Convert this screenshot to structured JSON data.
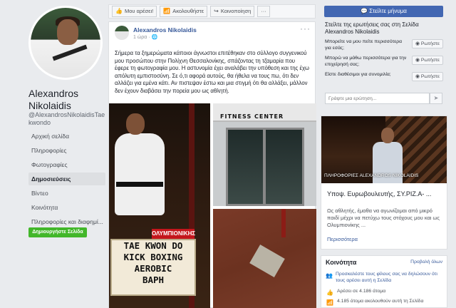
{
  "page": {
    "name": "Alexandros Nikolaidis",
    "handle": "@AlexandrosNikolaidisTaekwondo",
    "nav": [
      "Αρχική σελίδα",
      "Πληροφορίες",
      "Φωτογραφίες",
      "Δημοσιεύσεις",
      "Βίντεο",
      "Κοινότητα",
      "Πληροφορίες και διαφημί..."
    ],
    "create_page": "Δημιουργήστε Σελίδα"
  },
  "actions": {
    "like": "Μου αρέσει!",
    "follow": "Ακολουθήστε",
    "share": "Κοινοποίηση",
    "more": "···"
  },
  "post": {
    "author": "Alexandros Nikolaidis",
    "time": "1 ώρα · ",
    "more": "···",
    "text": "Σήμερα τα ξημερώματα κάποιοι άγνωστοι επιτέθηκαν στο σύλλογο συγγενικού μου προσώπου στην Πολίχνη Θεσσαλονίκης, σπάζοντας τη τζαμαρία που έφερε τη φωτογραφία μου. Η αστυνομία έχει αναλάβει την υπόθεση και της έχω απόλυτη εμπιστοσύνη. Σε ό,τι αφορά αυτούς, θα ήθελα να τους πω, ότι δεν αλλάζει για εμένα κάτι. Αν πιστεψαν έστω και μια στιγμή ότι θα αλλάξει, μάλλον δεν έχουν διαβάσει την πορεία μου ως αθλητή.",
    "photo_signs": {
      "olympic": "ΟΛΥΜΠΙΟΝΙΚΗΣ",
      "board": [
        "TAE KWON DO",
        "KICK BOXING",
        "AEROBIC",
        "ΒΑΡΗ"
      ],
      "gym": "FITNESS CENTER"
    }
  },
  "sidebar": {
    "message_button": "Στείλτε μήνυμα",
    "qa_title": "Στείλτε της ερωτήσεις σας στη Σελίδα Alexandros Nikolaidis",
    "questions": [
      {
        "text": "Μπορείτε να μου πείτε περισσότερα για εσάς;",
        "ask": "Ρωτήστε"
      },
      {
        "text": "Μπορώ να μάθω περισσότερα για την επιχείρησή σας;",
        "ask": "Ρωτήστε"
      },
      {
        "text": "Είστε διαθέσιμοι για συνομιλία;",
        "ask": "Ρωτήστε"
      }
    ],
    "qa_placeholder": "Γράψτε μια ερώτηση...",
    "qa_send": "➤",
    "info_caption": "ΠΛΗΡΟΦΟΡΙΕΣ ALEXANDROS NIKOLAIDIS",
    "info_name": "Υποψ. Ευρωβουλευτής, ΣΥ.ΡΙΖ.Α- ...",
    "info_desc": "Ως αθλητής, έμαθα να αγωνίζομαι από μικρό παιδί μέχρι να πετύχω τους στόχους μου και ως Ολυμπιονίκης ...",
    "info_more": "Περισσότερα",
    "community_title": "Κοινότητα",
    "community_all": "Προβολή όλων",
    "community_rows": [
      {
        "icon": "invite-icon",
        "text": "Προσκαλέστε τους φίλους σας να δηλώσουν ότι τους αρέσει αυτή η Σελίδα"
      },
      {
        "icon": "like-icon",
        "text": "Αρέσει σε 4.186 άτομα"
      },
      {
        "icon": "follow-icon",
        "text": "4.185 άτομα ακολουθούν αυτή τη Σελίδα"
      }
    ]
  },
  "colors": {
    "brand": "#4267b2",
    "link": "#365899",
    "create_green": "#42b72a",
    "background": "#e9ebee"
  }
}
